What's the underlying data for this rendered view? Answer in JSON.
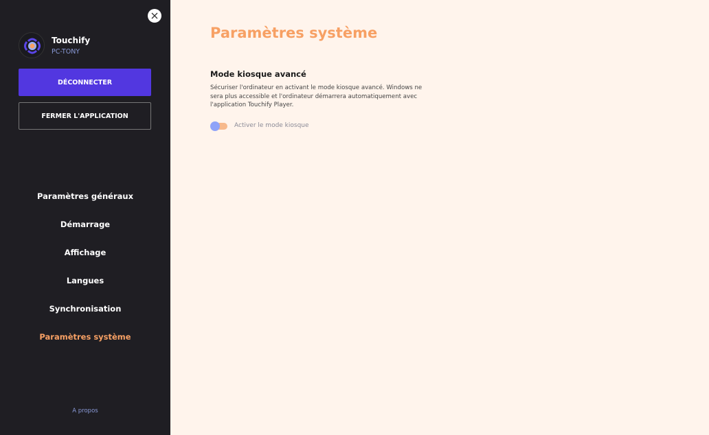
{
  "sidebar": {
    "app_name": "Touchify",
    "pc_name": "PC-TONY",
    "disconnect_label": "DÉCONNECTER",
    "close_app_label": "FERMER L'APPLICATION",
    "items": [
      {
        "label": "Paramètres généraux"
      },
      {
        "label": "Démarrage"
      },
      {
        "label": "Affichage"
      },
      {
        "label": "Langues"
      },
      {
        "label": "Synchronisation"
      },
      {
        "label": "Paramètres système",
        "active": true
      }
    ],
    "about_label": "A propos"
  },
  "main": {
    "title": "Paramètres système",
    "section_title": "Mode kiosque avancé",
    "section_description": "Sécuriser l'ordinateur en activant le mode kiosque avancé. Windows ne sera plus accessible et l'ordinateur démarrera automatiquement avec l'application Touchify Player.",
    "toggle_label": "Activer le mode kiosque",
    "toggle_on": false
  },
  "colors": {
    "accent": "#f7a064",
    "primary": "#5237e0",
    "sidebar_bg": "#1f1e23",
    "content_bg": "#fff4ec"
  }
}
